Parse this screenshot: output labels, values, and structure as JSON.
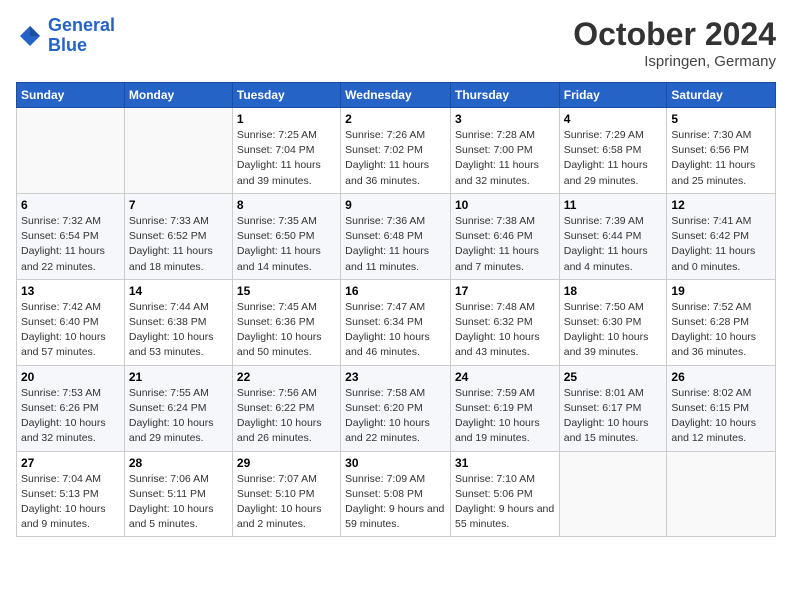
{
  "header": {
    "logo_line1": "General",
    "logo_line2": "Blue",
    "month": "October 2024",
    "location": "Ispringen, Germany"
  },
  "weekdays": [
    "Sunday",
    "Monday",
    "Tuesday",
    "Wednesday",
    "Thursday",
    "Friday",
    "Saturday"
  ],
  "weeks": [
    [
      {
        "day": "",
        "info": ""
      },
      {
        "day": "",
        "info": ""
      },
      {
        "day": "1",
        "info": "Sunrise: 7:25 AM\nSunset: 7:04 PM\nDaylight: 11 hours and 39 minutes."
      },
      {
        "day": "2",
        "info": "Sunrise: 7:26 AM\nSunset: 7:02 PM\nDaylight: 11 hours and 36 minutes."
      },
      {
        "day": "3",
        "info": "Sunrise: 7:28 AM\nSunset: 7:00 PM\nDaylight: 11 hours and 32 minutes."
      },
      {
        "day": "4",
        "info": "Sunrise: 7:29 AM\nSunset: 6:58 PM\nDaylight: 11 hours and 29 minutes."
      },
      {
        "day": "5",
        "info": "Sunrise: 7:30 AM\nSunset: 6:56 PM\nDaylight: 11 hours and 25 minutes."
      }
    ],
    [
      {
        "day": "6",
        "info": "Sunrise: 7:32 AM\nSunset: 6:54 PM\nDaylight: 11 hours and 22 minutes."
      },
      {
        "day": "7",
        "info": "Sunrise: 7:33 AM\nSunset: 6:52 PM\nDaylight: 11 hours and 18 minutes."
      },
      {
        "day": "8",
        "info": "Sunrise: 7:35 AM\nSunset: 6:50 PM\nDaylight: 11 hours and 14 minutes."
      },
      {
        "day": "9",
        "info": "Sunrise: 7:36 AM\nSunset: 6:48 PM\nDaylight: 11 hours and 11 minutes."
      },
      {
        "day": "10",
        "info": "Sunrise: 7:38 AM\nSunset: 6:46 PM\nDaylight: 11 hours and 7 minutes."
      },
      {
        "day": "11",
        "info": "Sunrise: 7:39 AM\nSunset: 6:44 PM\nDaylight: 11 hours and 4 minutes."
      },
      {
        "day": "12",
        "info": "Sunrise: 7:41 AM\nSunset: 6:42 PM\nDaylight: 11 hours and 0 minutes."
      }
    ],
    [
      {
        "day": "13",
        "info": "Sunrise: 7:42 AM\nSunset: 6:40 PM\nDaylight: 10 hours and 57 minutes."
      },
      {
        "day": "14",
        "info": "Sunrise: 7:44 AM\nSunset: 6:38 PM\nDaylight: 10 hours and 53 minutes."
      },
      {
        "day": "15",
        "info": "Sunrise: 7:45 AM\nSunset: 6:36 PM\nDaylight: 10 hours and 50 minutes."
      },
      {
        "day": "16",
        "info": "Sunrise: 7:47 AM\nSunset: 6:34 PM\nDaylight: 10 hours and 46 minutes."
      },
      {
        "day": "17",
        "info": "Sunrise: 7:48 AM\nSunset: 6:32 PM\nDaylight: 10 hours and 43 minutes."
      },
      {
        "day": "18",
        "info": "Sunrise: 7:50 AM\nSunset: 6:30 PM\nDaylight: 10 hours and 39 minutes."
      },
      {
        "day": "19",
        "info": "Sunrise: 7:52 AM\nSunset: 6:28 PM\nDaylight: 10 hours and 36 minutes."
      }
    ],
    [
      {
        "day": "20",
        "info": "Sunrise: 7:53 AM\nSunset: 6:26 PM\nDaylight: 10 hours and 32 minutes."
      },
      {
        "day": "21",
        "info": "Sunrise: 7:55 AM\nSunset: 6:24 PM\nDaylight: 10 hours and 29 minutes."
      },
      {
        "day": "22",
        "info": "Sunrise: 7:56 AM\nSunset: 6:22 PM\nDaylight: 10 hours and 26 minutes."
      },
      {
        "day": "23",
        "info": "Sunrise: 7:58 AM\nSunset: 6:20 PM\nDaylight: 10 hours and 22 minutes."
      },
      {
        "day": "24",
        "info": "Sunrise: 7:59 AM\nSunset: 6:19 PM\nDaylight: 10 hours and 19 minutes."
      },
      {
        "day": "25",
        "info": "Sunrise: 8:01 AM\nSunset: 6:17 PM\nDaylight: 10 hours and 15 minutes."
      },
      {
        "day": "26",
        "info": "Sunrise: 8:02 AM\nSunset: 6:15 PM\nDaylight: 10 hours and 12 minutes."
      }
    ],
    [
      {
        "day": "27",
        "info": "Sunrise: 7:04 AM\nSunset: 5:13 PM\nDaylight: 10 hours and 9 minutes."
      },
      {
        "day": "28",
        "info": "Sunrise: 7:06 AM\nSunset: 5:11 PM\nDaylight: 10 hours and 5 minutes."
      },
      {
        "day": "29",
        "info": "Sunrise: 7:07 AM\nSunset: 5:10 PM\nDaylight: 10 hours and 2 minutes."
      },
      {
        "day": "30",
        "info": "Sunrise: 7:09 AM\nSunset: 5:08 PM\nDaylight: 9 hours and 59 minutes."
      },
      {
        "day": "31",
        "info": "Sunrise: 7:10 AM\nSunset: 5:06 PM\nDaylight: 9 hours and 55 minutes."
      },
      {
        "day": "",
        "info": ""
      },
      {
        "day": "",
        "info": ""
      }
    ]
  ]
}
